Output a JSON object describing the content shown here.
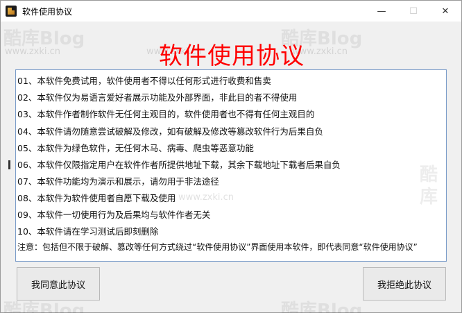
{
  "window": {
    "title": "软件使用协议",
    "controls": [
      "—",
      "☐",
      "✕"
    ]
  },
  "watermarks": {
    "brand": "酷库Blog",
    "url": "www.zxki.cn"
  },
  "main": {
    "heading": "软件使用协议",
    "agreement_lines": [
      "01、本软件免费试用，软件使用者不得以任何形式进行收费和售卖",
      "02、本软件仅为易语言爱好者展示功能及外部界面，非此目的者不得使用",
      "03、本软件作者制作软件无任何主观目的，软件使用者也不得有任何主观目的",
      "04、本软件请勿随意尝试破解及修改，如有破解及修改等篡改软件行为后果自负",
      "05、本软件为绿色软件，无任何木马、病毒、爬虫等恶意功能",
      "06、本软件仅限指定用户在软件作者所提供地址下载，其余下载地址下载者后果自负",
      "07、本软件功能均为演示和展示，请勿用于非法途径",
      "08、本软件为软件使用者自愿下载及使用",
      "09、本软件一切使用行为及后果均与软件作者无关",
      "10、本软件请在学习测试后即刻删除",
      "注意：包括但不限于破解、篡改等任何方式绕过“软件使用协议”界面使用本软件，即代表同意“软件使用协议”"
    ]
  },
  "buttons": {
    "agree": "我同意此协议",
    "reject": "我拒绝此协议"
  }
}
